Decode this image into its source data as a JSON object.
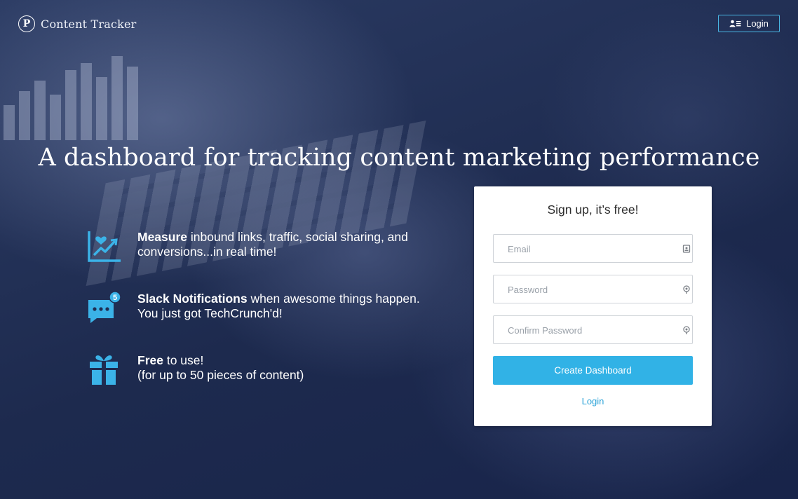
{
  "brand": {
    "logo_letter": "P",
    "name": "Content Tracker"
  },
  "header": {
    "login_label": "Login",
    "login_icon": "user-list-icon"
  },
  "hero": {
    "headline": "A dashboard for tracking content marketing performance"
  },
  "features": [
    {
      "icon": "chart-heart-icon",
      "bold": "Measure",
      "rest": " inbound links, traffic, social sharing, and",
      "line2": "conversions...in real time!"
    },
    {
      "icon": "chat-notification-icon",
      "badge": "5",
      "bold": "Slack Notifications",
      "rest": " when awesome things happen.",
      "line2": "You just got TechCrunch'd!"
    },
    {
      "icon": "gift-icon",
      "bold": "Free",
      "rest": " to use!",
      "line2": "(for up to 50 pieces of content)"
    }
  ],
  "signup": {
    "title": "Sign up, it’s free!",
    "email_placeholder": "Email",
    "password_placeholder": "Password",
    "confirm_placeholder": "Confirm Password",
    "submit_label": "Create Dashboard",
    "login_link": "Login"
  },
  "colors": {
    "accent": "#31b2e6",
    "background": "#1f2d52",
    "card": "#ffffff"
  }
}
